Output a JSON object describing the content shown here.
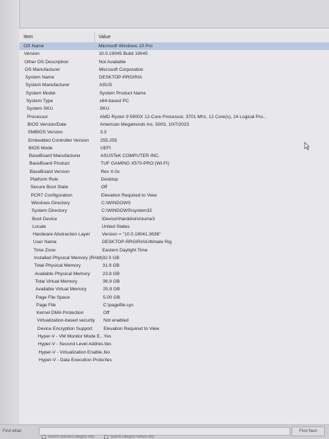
{
  "table": {
    "header_item": "Item",
    "header_value": "Value",
    "rows": [
      {
        "item": "OS Name",
        "value": "Microsoft Windows 10 Pro"
      },
      {
        "item": "Version",
        "value": "10.0.19045 Build 19045"
      },
      {
        "item": "Other OS Description",
        "value": "Not Available"
      },
      {
        "item": "OS Manufacturer",
        "value": "Microsoft Corporation"
      },
      {
        "item": "System Name",
        "value": "DESKTOP-RRGIRIA"
      },
      {
        "item": "System Manufacturer",
        "value": "ASUS"
      },
      {
        "item": "System Model",
        "value": "System Product Name"
      },
      {
        "item": "System Type",
        "value": "x64-based PC"
      },
      {
        "item": "System SKU",
        "value": "SKU"
      },
      {
        "item": "Processor",
        "value": "AMD Ryzen 9 5900X 12-Core Processor, 3701 Mhz, 12 Core(s), 24 Logical Pro..."
      },
      {
        "item": "BIOS Version/Date",
        "value": "American Megatrends Inc. 5003, 10/7/2023"
      },
      {
        "item": "SMBIOS Version",
        "value": "3.3"
      },
      {
        "item": "Embedded Controller Version",
        "value": "255.255"
      },
      {
        "item": "BIOS Mode",
        "value": "UEFI"
      },
      {
        "item": "BaseBoard Manufacturer",
        "value": "ASUSTeK COMPUTER INC."
      },
      {
        "item": "BaseBoard Product",
        "value": "TUF GAMING X570-PRO (WI-FI)"
      },
      {
        "item": "BaseBoard Version",
        "value": "Rev X.0x"
      },
      {
        "item": "Platform Role",
        "value": "Desktop"
      },
      {
        "item": "Secure Boot State",
        "value": "Off"
      },
      {
        "item": "PCR7 Configuration",
        "value": "Elevation Required to View"
      },
      {
        "item": "Windows Directory",
        "value": "C:\\WINDOWS"
      },
      {
        "item": "System Directory",
        "value": "C:\\WINDOWS\\system32"
      },
      {
        "item": "Boot Device",
        "value": "\\Device\\HarddiskVolume3"
      },
      {
        "item": "Locale",
        "value": "United States"
      },
      {
        "item": "Hardware Abstraction Layer",
        "value": "Version = \"10.0.19041.3636\""
      },
      {
        "item": "User Name",
        "value": "DESKTOP-RRGIRIA\\Ultimate Rig"
      },
      {
        "item": "Time Zone",
        "value": "Eastern Daylight Time"
      },
      {
        "item": "Installed Physical Memory (RAM)",
        "value": "32.0 GB"
      },
      {
        "item": "Total Physical Memory",
        "value": "31.9 GB"
      },
      {
        "item": "Available Physical Memory",
        "value": "23.8 GB"
      },
      {
        "item": "Total Virtual Memory",
        "value": "36.9 GB"
      },
      {
        "item": "Available Virtual Memory",
        "value": "25.9 GB"
      },
      {
        "item": "Page File Space",
        "value": "5.00 GB"
      },
      {
        "item": "Page File",
        "value": "C:\\pagefile.sys"
      },
      {
        "item": "Kernel DMA Protection",
        "value": "Off"
      },
      {
        "item": "Virtualization-based security",
        "value": "Not enabled"
      },
      {
        "item": "Device Encryption Support",
        "value": "Elevation Required to View"
      },
      {
        "item": "Hyper-V - VM Monitor Mode E...",
        "value": "Yes"
      },
      {
        "item": "Hyper-V - Second Level Addres...",
        "value": "Yes"
      },
      {
        "item": "Hyper-V - Virtualization Enable...",
        "value": "No"
      },
      {
        "item": "Hyper-V - Data Execution Prote...",
        "value": "Yes"
      }
    ]
  },
  "find_bar": {
    "label": "Find what:",
    "value": "",
    "find_next_label": "Find Next",
    "option_1": "Search selected category only",
    "option_2": "Search category names only"
  },
  "colors": {
    "selected_row": "#b9c7e0",
    "panel_background": "#e8e8ea"
  }
}
